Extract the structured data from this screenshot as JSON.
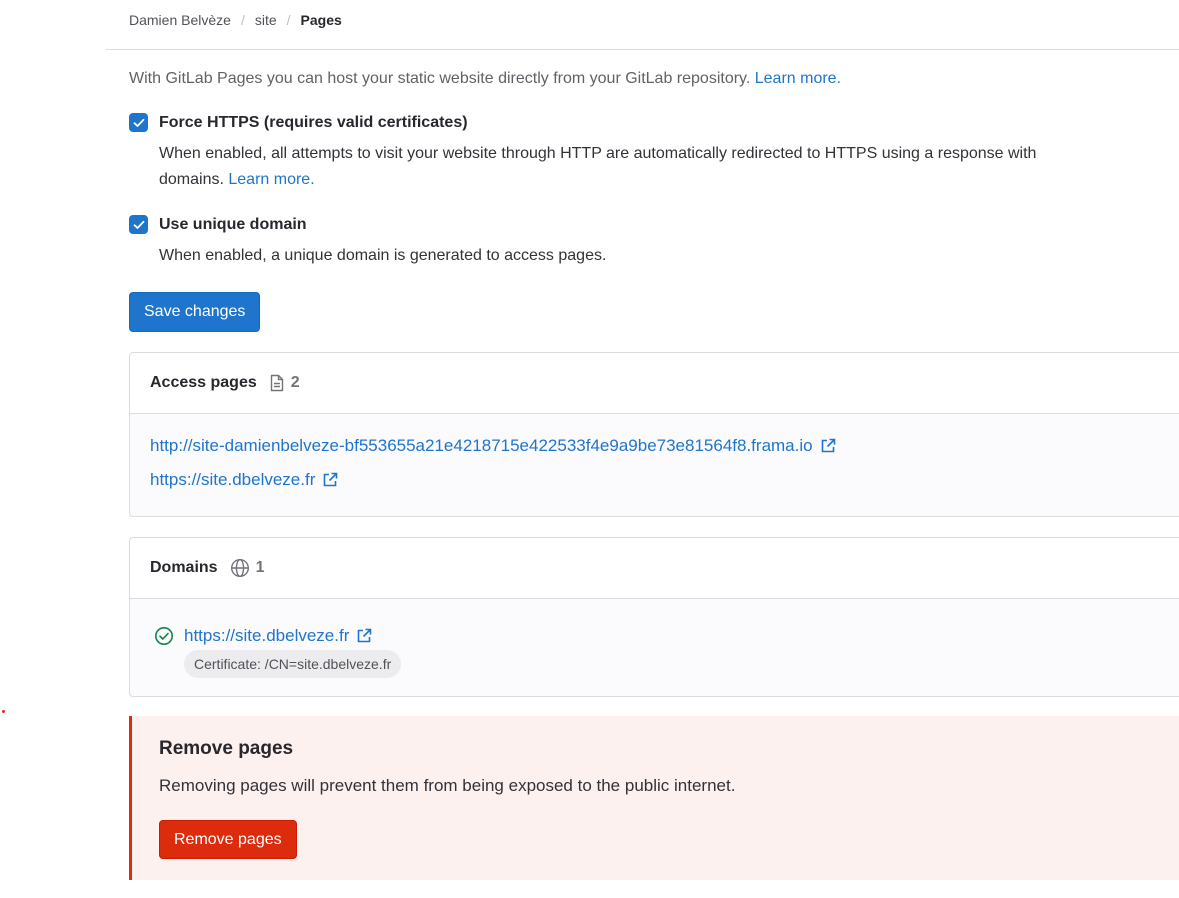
{
  "breadcrumb": {
    "items": [
      "Damien Belvèze",
      "site"
    ],
    "current": "Pages",
    "separator": "/"
  },
  "intro": {
    "text": "With GitLab Pages you can host your static website directly from your GitLab repository. ",
    "link": "Learn more."
  },
  "force_https": {
    "checked": true,
    "label": "Force HTTPS (requires valid certificates)",
    "help_line1": "When enabled, all attempts to visit your website through HTTP are automatically redirected to HTTPS using a response with",
    "help_line2": "domains. ",
    "help_link": "Learn more."
  },
  "unique_domain": {
    "checked": true,
    "label": "Use unique domain",
    "help": "When enabled, a unique domain is generated to access pages."
  },
  "save_button": "Save changes",
  "access_pages": {
    "title": "Access pages",
    "count": "2",
    "icon": "document-icon",
    "links": [
      "http://site-damienbelveze-bf553655a21e4218715e422533f4e9a9be73e81564f8.frama.io",
      "https://site.dbelveze.fr"
    ]
  },
  "domains": {
    "title": "Domains",
    "count": "1",
    "icon": "globe-icon",
    "items": [
      {
        "url": "https://site.dbelveze.fr",
        "status_icon": "check-circle-icon",
        "certificate": "Certificate: /CN=site.dbelveze.fr"
      }
    ]
  },
  "remove": {
    "title": "Remove pages",
    "description": "Removing pages will prevent them from being exposed to the public internet.",
    "button": "Remove pages"
  },
  "colors": {
    "link": "#1f75cb",
    "primary": "#1f75cb",
    "danger": "#dd2b0e",
    "danger_bg": "#fcf1ef",
    "success": "#108548"
  }
}
